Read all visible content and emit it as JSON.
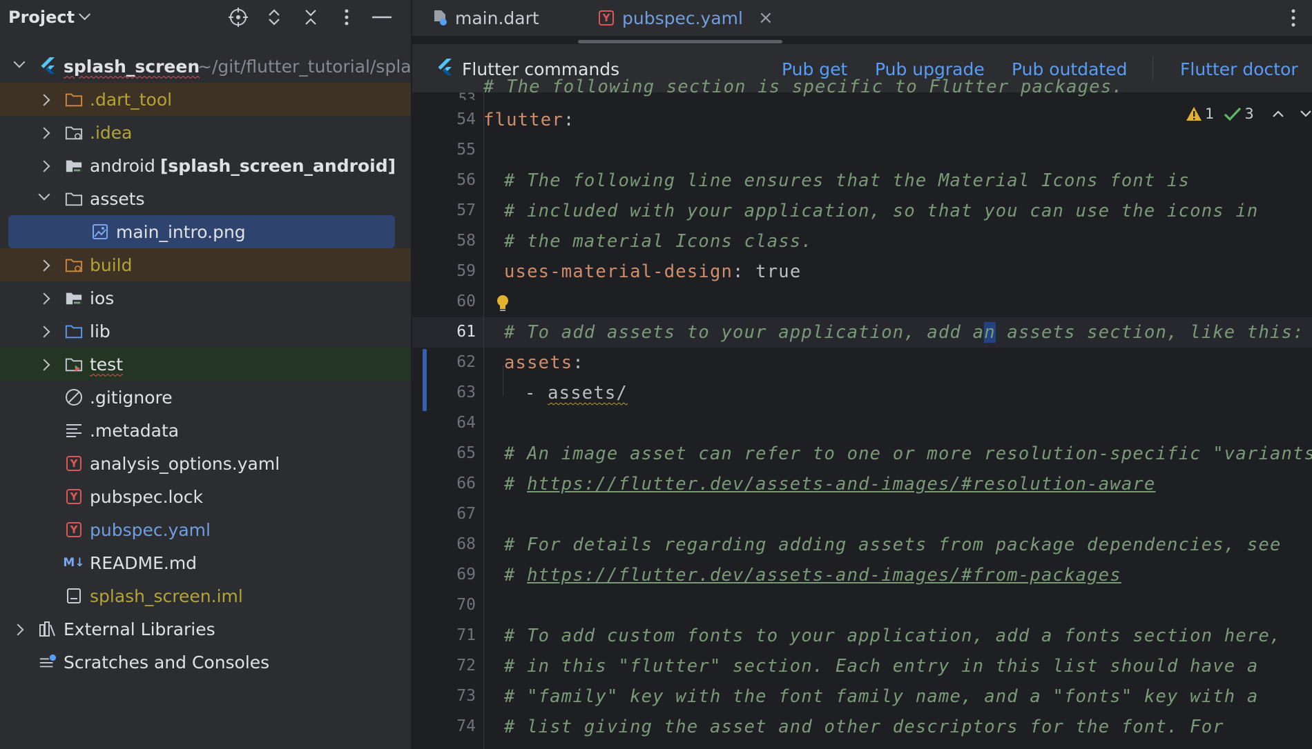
{
  "project": {
    "title": "Project",
    "tree": [
      {
        "label": "splash_screen",
        "suffix": "~/git/flutter_tutorial/splas"
      },
      {
        "label": ".dart_tool"
      },
      {
        "label": ".idea"
      },
      {
        "label": "android",
        "suffix": "[splash_screen_android]"
      },
      {
        "label": "assets"
      },
      {
        "label": "main_intro.png"
      },
      {
        "label": "build"
      },
      {
        "label": "ios"
      },
      {
        "label": "lib"
      },
      {
        "label": "test"
      },
      {
        "label": ".gitignore"
      },
      {
        "label": ".metadata"
      },
      {
        "label": "analysis_options.yaml"
      },
      {
        "label": "pubspec.lock"
      },
      {
        "label": "pubspec.yaml"
      },
      {
        "label": "README.md"
      },
      {
        "label": "splash_screen.iml"
      },
      {
        "label": "External Libraries"
      },
      {
        "label": "Scratches and Consoles"
      }
    ]
  },
  "tabs": [
    {
      "label": "main.dart"
    },
    {
      "label": "pubspec.yaml",
      "close": "×"
    }
  ],
  "flutter_bar": {
    "title": "Flutter commands",
    "actions": [
      "Pub get",
      "Pub upgrade",
      "Pub outdated",
      "Flutter doctor"
    ]
  },
  "inspections": {
    "warnings": "1",
    "ok": "3"
  },
  "md_badge": "M↓",
  "yaml_badge": "Y",
  "code": {
    "top_fragment": "# The following section is specific to Flutter packages.",
    "lines": [
      {
        "n": "54",
        "key": "flutter",
        "sep": ":"
      },
      {
        "n": "55"
      },
      {
        "n": "56",
        "comment": "# The following line ensures that the Material Icons font is"
      },
      {
        "n": "57",
        "comment": "# included with your application, so that you can use the icons in"
      },
      {
        "n": "58",
        "comment": "# the material Icons class."
      },
      {
        "n": "59",
        "key": "uses-material-design",
        "sep": ": ",
        "value": "true"
      },
      {
        "n": "60"
      },
      {
        "n": "61",
        "comment_a": "# To add assets to your application, add a",
        "comment_b": "n",
        "comment_c": " assets section, like this:"
      },
      {
        "n": "62",
        "key": "assets",
        "sep": ":"
      },
      {
        "n": "63",
        "dash": "- ",
        "value": "assets/"
      },
      {
        "n": "64"
      },
      {
        "n": "65",
        "comment": "# An image asset can refer to one or more resolution-specific \"variants\", s"
      },
      {
        "n": "66",
        "hash": "# ",
        "link": "https://flutter.dev/assets-and-images/#resolution-aware"
      },
      {
        "n": "67"
      },
      {
        "n": "68",
        "comment": "# For details regarding adding assets from package dependencies, see"
      },
      {
        "n": "69",
        "hash": "# ",
        "link": "https://flutter.dev/assets-and-images/#from-packages"
      },
      {
        "n": "70"
      },
      {
        "n": "71",
        "comment": "# To add custom fonts to your application, add a fonts section here,"
      },
      {
        "n": "72",
        "comment": "# in this \"flutter\" section. Each entry in this list should have a"
      },
      {
        "n": "73",
        "comment": "# \"family\" key with the font family name, and a \"fonts\" key with a"
      },
      {
        "n": "74",
        "comment": "# list giving the asset and other descriptors for the font. For"
      }
    ]
  }
}
